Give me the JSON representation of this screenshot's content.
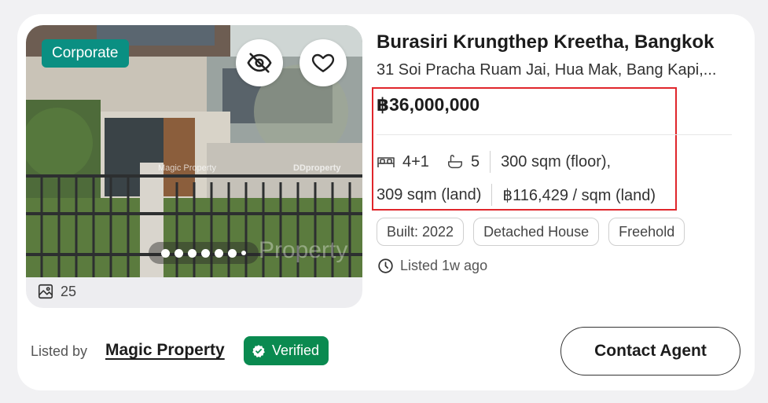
{
  "listing": {
    "tag": "Corporate",
    "photo_count": "25",
    "carousel": {
      "visible_dots": 7
    },
    "watermarks": {
      "agent": "Magic Property",
      "portal": "DDproperty",
      "large": "Property"
    },
    "title": "Burasiri Krungthep Kreetha, Bangkok",
    "address": "31 Soi Pracha Ruam Jai, Hua Mak, Bang Kapi,...",
    "price": "฿36,000,000",
    "specs": {
      "bedrooms": "4+1",
      "bathrooms": "5",
      "floor_area": "300 sqm (floor),",
      "land_area": "309 sqm (land)",
      "price_per_sqm": "฿116,429 / sqm (land)"
    },
    "tags": [
      "Built: 2022",
      "Detached House",
      "Freehold"
    ],
    "listed_time": "Listed 1w ago"
  },
  "footer": {
    "listed_by_label": "Listed by",
    "agent_name": "Magic Property",
    "verified_label": "Verified",
    "contact_button": "Contact Agent"
  },
  "icons": {
    "hide": "eye-off-icon",
    "favorite": "heart-icon",
    "photos": "image-icon",
    "bed": "bed-icon",
    "bath": "bathtub-icon",
    "clock": "clock-icon",
    "verified": "badge-check-icon"
  },
  "colors": {
    "tag_bg": "#0a8f82",
    "verified_bg": "#0a8a50",
    "highlight_border": "#e0262b"
  }
}
